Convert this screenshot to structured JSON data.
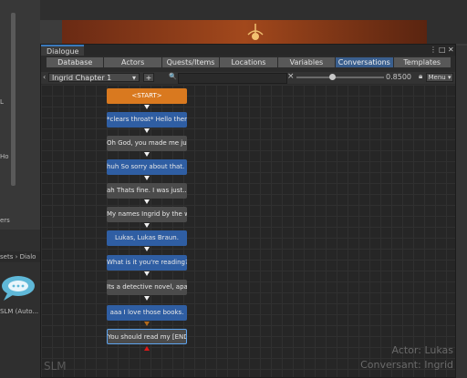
{
  "background": {
    "left_fragments": [
      "L",
      "Ho",
      "ers"
    ],
    "project_bar": "sets › Dialo",
    "asset_label": "SLM (Auto..."
  },
  "window": {
    "title": "Dialogue",
    "icons": [
      "menu-dots-icon",
      "maximize-icon",
      "close-icon"
    ],
    "tabs": [
      "Database",
      "Actors",
      "Quests/Items",
      "Locations",
      "Variables",
      "Conversations",
      "Templates"
    ],
    "active_tab": "Conversations"
  },
  "toolbar": {
    "conversation": "Ingrid Chapter 1",
    "add_label": "+",
    "search_placeholder": "",
    "clear_label": "×",
    "zoom": "0.8500",
    "menu_label": "Menu ▾"
  },
  "canvas": {
    "nodes": [
      {
        "text": "<START>",
        "style": "start"
      },
      {
        "text": "*clears throat* Hello ther",
        "style": "blue"
      },
      {
        "text": "Oh God, you made me jump!",
        "style": "gray"
      },
      {
        "text": "huh So sorry about that. I",
        "style": "blue"
      },
      {
        "text": "ah Thats fine. I was just...",
        "style": "gray"
      },
      {
        "text": "My names Ingrid by the way",
        "style": "gray"
      },
      {
        "text": "Lukas, Lukas Braun.",
        "style": "blue"
      },
      {
        "text": "What is it you're reading?",
        "style": "blue"
      },
      {
        "text": "Its a detective novel, apa",
        "style": "gray"
      },
      {
        "text": "aaa I love those books.",
        "style": "blue"
      },
      {
        "text": "You should read my   [END]",
        "style": "sel"
      }
    ],
    "watermark": "SLM",
    "actor": "Actor: Lukas",
    "conversant": "Conversant: Ingrid"
  }
}
